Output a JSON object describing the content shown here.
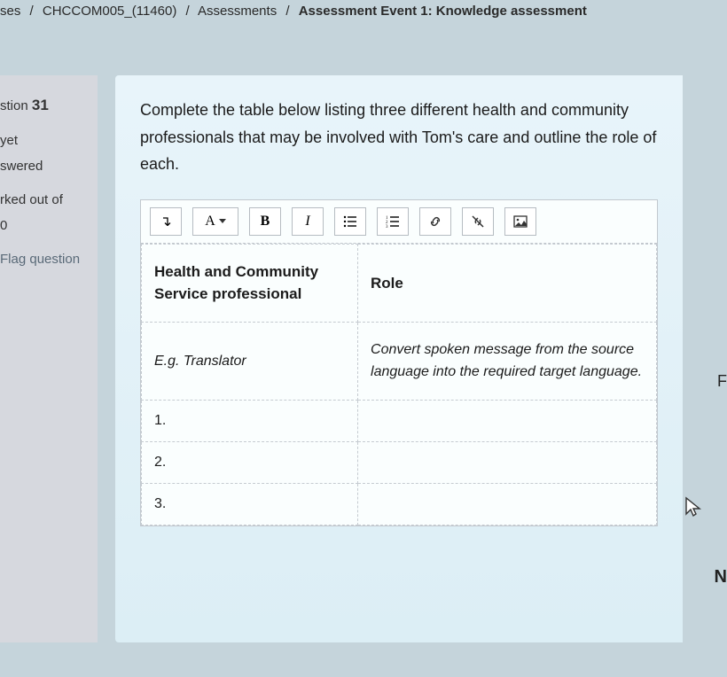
{
  "breadcrumb": {
    "item1": "ses",
    "item2": "CHCCOM005_(11460)",
    "item3": "Assessments",
    "item4": "Assessment Event 1: Knowledge assessment",
    "sep": "/"
  },
  "sidebar": {
    "question_label_prefix": "stion ",
    "question_number": "31",
    "status_line1": "yet",
    "status_line2": "swered",
    "marked_line": "rked out of",
    "marked_value": "0",
    "flag_label": "Flag question"
  },
  "question": {
    "prompt": "Complete the table below listing three different health and community professionals that may be involved with Tom's care and outline the role of each."
  },
  "toolbar": {
    "expand": "↴",
    "font_label": "A",
    "bold_label": "B",
    "italic_label": "I"
  },
  "table": {
    "col1_header": "Health and Community Service professional",
    "col2_header": "Role",
    "example_col1": "E.g. Translator",
    "example_col2": "Convert spoken message from the source language into the required target language.",
    "row1": "1.",
    "row2": "2.",
    "row3": "3."
  },
  "edge": {
    "f": "F",
    "n": "N"
  }
}
